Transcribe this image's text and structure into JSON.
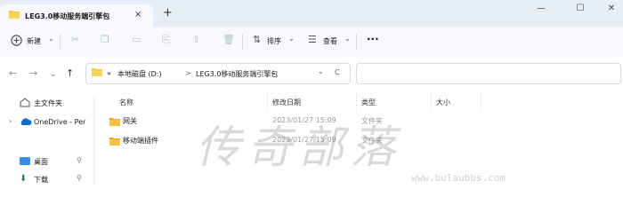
{
  "tab": {
    "title": "LEG3.0移动服务端引擎包",
    "close": "×",
    "add": "+"
  },
  "window": {
    "minimize": "—",
    "maximize": "☐",
    "close": "✕"
  },
  "toolbar": {
    "new_label": "新建",
    "sort_label": "排序",
    "view_label": "查看",
    "more": "···"
  },
  "nav": {
    "back": "←",
    "forward": "→",
    "up": "↑",
    "refresh": "C"
  },
  "address": {
    "prefix": "«",
    "drive": "本地磁盘 (D:)",
    "separator": ">",
    "folder": "LEG3.0移动服务端引擎包",
    "dropdown": "⌄"
  },
  "sidebar": {
    "items": [
      {
        "label": "主文件夹"
      },
      {
        "label": "OneDrive - Per"
      },
      {
        "label": "桌面",
        "pin": "📌"
      },
      {
        "label": "下载",
        "pin": "📌"
      }
    ]
  },
  "columns": {
    "name": "名称",
    "modified": "修改日期",
    "type": "类型",
    "size": "大小"
  },
  "files": [
    {
      "name": "网关",
      "modified": "2023/01/27 15:09",
      "type": "文件夹"
    },
    {
      "name": "移动端插件",
      "modified": "2023/01/27 15:09",
      "type": "文件夹"
    }
  ],
  "watermark": {
    "text": "传奇部落",
    "url": "www.bulaubbs.com"
  },
  "colors": {
    "accent": "#0067c0",
    "folder": "#f5c242",
    "tabbar": "#e8eef7"
  }
}
